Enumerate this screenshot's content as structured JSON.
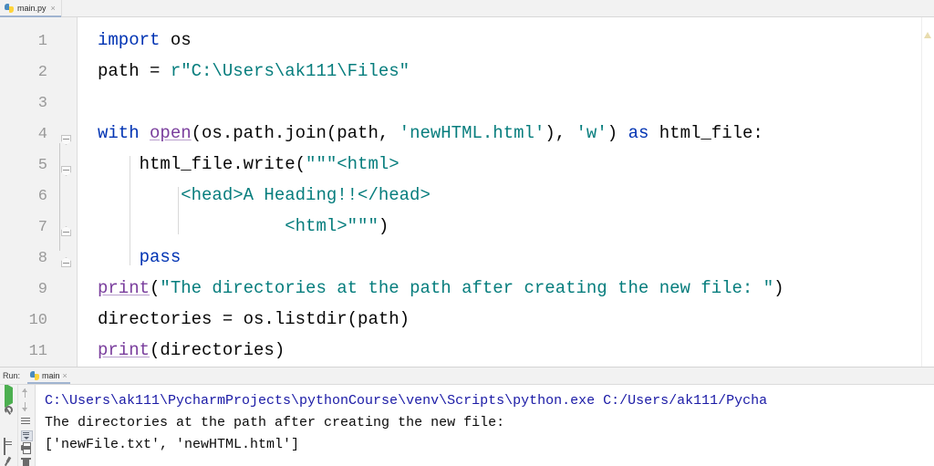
{
  "editor": {
    "tab": {
      "label": "main.py",
      "close": "×",
      "icon": "python-file-icon"
    },
    "line_numbers": [
      "1",
      "2",
      "3",
      "4",
      "5",
      "6",
      "7",
      "8",
      "9",
      "10",
      "11"
    ],
    "lines": [
      {
        "n": "1",
        "tokens": [
          {
            "t": "import",
            "c": "kw"
          },
          {
            "t": " os",
            "c": "plain"
          }
        ]
      },
      {
        "n": "2",
        "tokens": [
          {
            "t": "path = ",
            "c": "plain"
          },
          {
            "t": "r\"C:\\Users\\ak111\\Files\"",
            "c": "str"
          }
        ]
      },
      {
        "n": "3",
        "tokens": []
      },
      {
        "n": "4",
        "tokens": [
          {
            "t": "with",
            "c": "kw"
          },
          {
            "t": " ",
            "c": "plain"
          },
          {
            "t": "open",
            "c": "fn"
          },
          {
            "t": "(os.path.join(path, ",
            "c": "plain"
          },
          {
            "t": "'newHTML.html'",
            "c": "str"
          },
          {
            "t": "), ",
            "c": "plain"
          },
          {
            "t": "'w'",
            "c": "str"
          },
          {
            "t": ") ",
            "c": "plain"
          },
          {
            "t": "as",
            "c": "kw"
          },
          {
            "t": " html_file:",
            "c": "plain"
          }
        ]
      },
      {
        "n": "5",
        "tokens": [
          {
            "t": "    html_file.write(",
            "c": "plain"
          },
          {
            "t": "\"\"\"<html>",
            "c": "str"
          }
        ]
      },
      {
        "n": "6",
        "tokens": [
          {
            "t": "        <head>A Heading!!</head>",
            "c": "str"
          }
        ]
      },
      {
        "n": "7",
        "tokens": [
          {
            "t": "                  <html>\"\"\"",
            "c": "str"
          },
          {
            "t": ")",
            "c": "plain"
          }
        ]
      },
      {
        "n": "8",
        "tokens": [
          {
            "t": "    ",
            "c": "plain"
          },
          {
            "t": "pass",
            "c": "kw"
          }
        ]
      },
      {
        "n": "9",
        "tokens": [
          {
            "t": "print",
            "c": "fn"
          },
          {
            "t": "(",
            "c": "plain"
          },
          {
            "t": "\"The directories at the path after creating the new file: \"",
            "c": "str"
          },
          {
            "t": ")",
            "c": "plain"
          }
        ]
      },
      {
        "n": "10",
        "tokens": [
          {
            "t": "directories = os.listdir(path)",
            "c": "plain"
          }
        ]
      },
      {
        "n": "11",
        "tokens": [
          {
            "t": "print",
            "c": "fn"
          },
          {
            "t": "(directories)",
            "c": "plain"
          }
        ]
      }
    ],
    "inspection_marker": "warning-triangle"
  },
  "run_panel": {
    "run_label": "Run:",
    "tab": {
      "label": "main",
      "close": "×",
      "icon": "python-run-config-icon"
    },
    "tools_left": [
      "rerun-play-icon",
      "settings-wrench-icon",
      "stop-icon",
      "layout-settings-icon",
      "pin-tab-icon"
    ],
    "tools_right": [
      "previous-occurrence-icon",
      "next-occurrence-icon",
      "soft-wrap-icon",
      "scroll-to-end-icon",
      "print-icon",
      "clear-all-icon"
    ],
    "console_lines": [
      {
        "text": "C:\\Users\\ak111\\PycharmProjects\\pythonCourse\\venv\\Scripts\\python.exe C:/Users/ak111/Pycha",
        "kind": "cmd"
      },
      {
        "text": "The directories at the path after creating the new file:",
        "kind": "out"
      },
      {
        "text": "['newFile.txt', 'newHTML.html']",
        "kind": "out"
      }
    ]
  },
  "colors": {
    "keyword": "#0033b3",
    "string": "#067d7d",
    "builtin_function": "#7a3e9d",
    "plain_text": "#080808",
    "console_command": "#1a1aa6",
    "gutter_bg": "#f2f2f2",
    "editor_bg": "#ffffff",
    "tab_underline": "#a0b4d0",
    "run_play": "#4caf50"
  }
}
